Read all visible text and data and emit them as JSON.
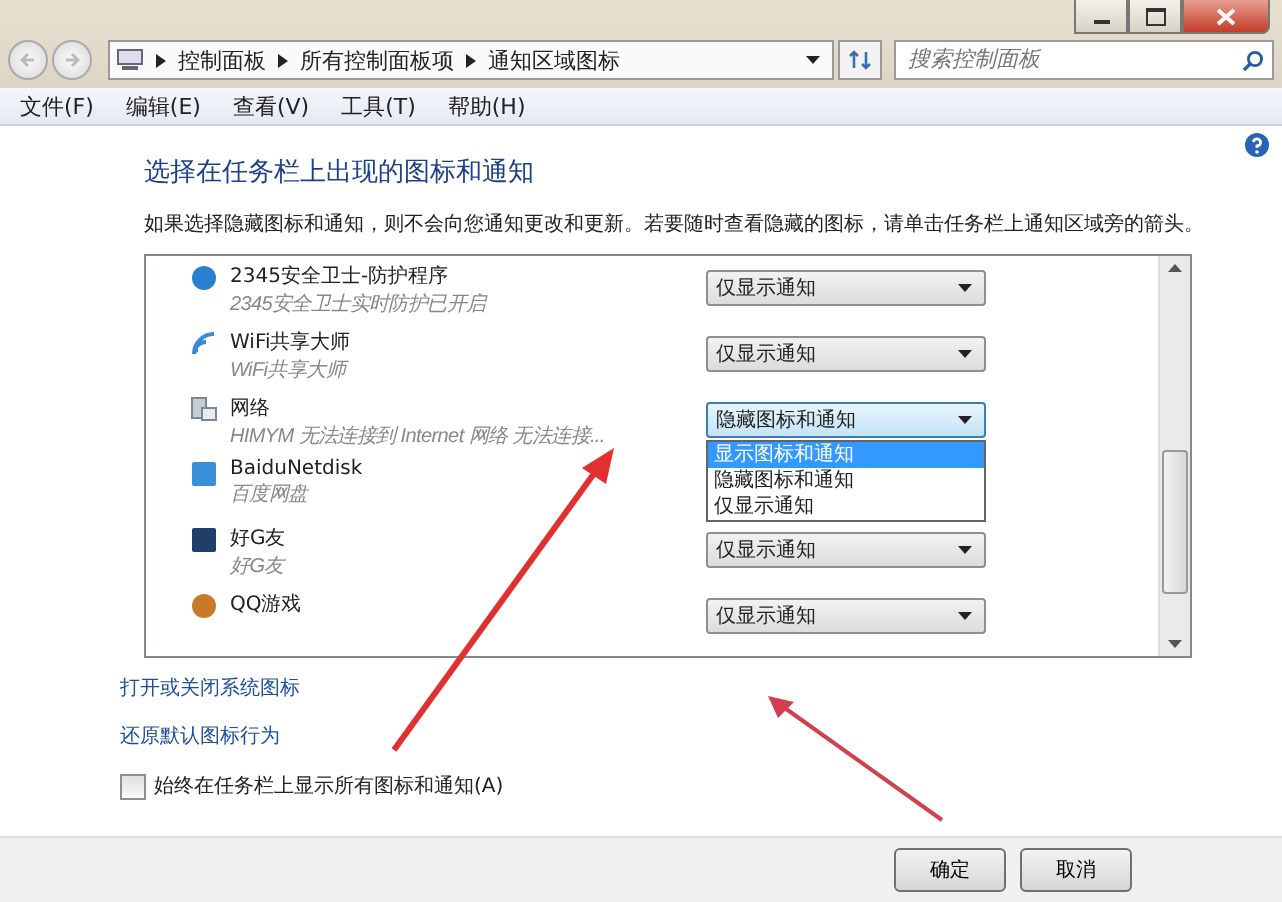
{
  "address_bar": {
    "crumbs": [
      "控制面板",
      "所有控制面板项",
      "通知区域图标"
    ]
  },
  "search": {
    "placeholder": "搜索控制面板"
  },
  "menu": [
    "文件(F)",
    "编辑(E)",
    "查看(V)",
    "工具(T)",
    "帮助(H)"
  ],
  "heading": "选择在任务栏上出现的图标和通知",
  "description": "如果选择隐藏图标和通知，则不会向您通知更改和更新。若要随时查看隐藏的图标，请单击任务栏上通知区域旁的箭头。",
  "apps": [
    {
      "kind": "shield",
      "name": "2345安全卫士-防护程序",
      "detail": "2345安全卫士实时防护已开启",
      "behavior": "仅显示通知",
      "expanded": false
    },
    {
      "kind": "wifi",
      "name": "WiFi共享大师",
      "detail": "WiFi共享大师",
      "behavior": "仅显示通知",
      "expanded": false
    },
    {
      "kind": "network",
      "name": "网络",
      "detail": "HIMYM 无法连接到 Internet 网络 无法连接...",
      "behavior": "隐藏图标和通知",
      "expanded": true,
      "options": [
        {
          "label": "显示图标和通知",
          "selected": true
        },
        {
          "label": "隐藏图标和通知",
          "selected": false
        },
        {
          "label": "仅显示通知",
          "selected": false
        }
      ]
    },
    {
      "kind": "cloud",
      "name": "BaiduNetdisk",
      "detail": "百度网盘",
      "expanded": false
    },
    {
      "kind": "friend",
      "name": "好G友",
      "detail": "好G友",
      "behavior": "仅显示通知",
      "expanded": false
    },
    {
      "kind": "game",
      "name": "QQ游戏",
      "behavior": "仅显示通知",
      "expanded": false
    }
  ],
  "links": [
    "打开或关闭系统图标",
    "还原默认图标行为"
  ],
  "always_show": {
    "label": "始终在任务栏上显示所有图标和通知(A)",
    "checked": false
  },
  "buttons": [
    "确定",
    "取消"
  ]
}
